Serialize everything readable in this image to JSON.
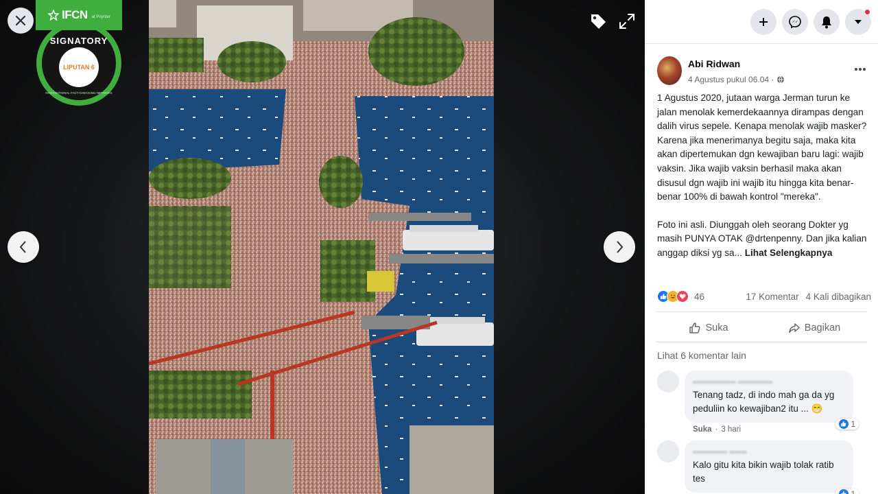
{
  "viewer": {
    "badge": {
      "org": "IFCN",
      "org_sub": "at Poynter",
      "signatory": "SIGNATORY",
      "logo_text": "LIPUTAN 6",
      "ring_text": "INTERNATIONAL FACT-CHECKING NETWORK"
    },
    "icons": {
      "close": "close-icon",
      "tag": "tag-icon",
      "fullscreen": "fullscreen-icon",
      "prev": "chevron-left-icon",
      "next": "chevron-right-icon"
    }
  },
  "header": {
    "buttons": [
      "plus-icon",
      "messenger-icon",
      "bell-icon",
      "caret-down-icon"
    ]
  },
  "post": {
    "author": "Abi Ridwan",
    "time": "4 Agustus pukul 06.04 ·",
    "body_p1": "1 Agustus 2020, jutaan warga Jerman turun ke jalan menolak kemerdekaannya dirampas dengan dalih virus sepele. Kenapa menolak wajib masker? Karena jika menerimanya begitu saja, maka kita akan dipertemukan dgn kewajiban baru lagi: wajib vaksin. Jika wajib vaksin berhasil maka akan disusul dgn wajib ini wajib itu hingga kita benar-benar 100% di bawah kontrol \"mereka\".",
    "body_p2": "Foto ini asli. Diunggah oleh seorang Dokter yg masih PUNYA OTAK @drtenpenny. Dan jika kalian anggap diksi yg sa...",
    "see_more": "Lihat Selengkapnya",
    "reaction_count": "46",
    "comments_count": "17 Komentar",
    "shares_count": "4 Kali dibagikan",
    "like_label": "Suka",
    "share_label": "Bagikan",
    "view_more_comments": "Lihat 6 komentar lain"
  },
  "comments": [
    {
      "text": "Tenang tadz, di indo mah ga da yg peduliin ko kewajiban2 itu ... 😁",
      "like_label": "Suka",
      "time": "3 hari",
      "likes": "1"
    },
    {
      "text": "Kalo gitu kita bikin wajib tolak ratib tes",
      "likes": "1"
    }
  ],
  "colors": {
    "ifcn_green": "#3fae3f",
    "fb_blue": "#1877f2",
    "notif_red": "#f02849"
  }
}
